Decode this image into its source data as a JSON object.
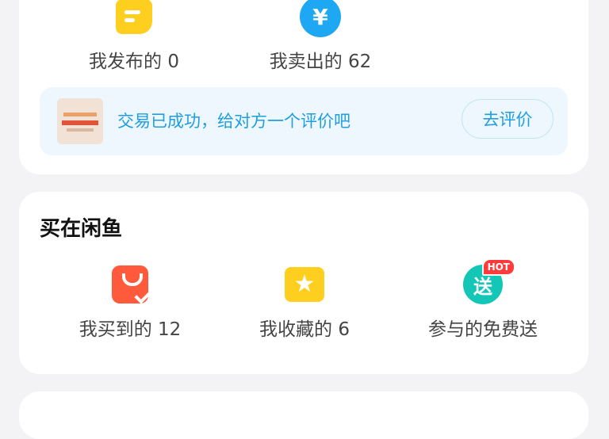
{
  "sell_section": {
    "items": [
      {
        "label": "我发布的 0",
        "icon": "note-icon"
      },
      {
        "label": "我卖出的 62",
        "icon": "yen-coin-icon",
        "glyph": "¥"
      }
    ],
    "banner": {
      "message": "交易已成功，给对方一个评价吧",
      "button_label": "去评价"
    }
  },
  "buy_section": {
    "title": "买在闲鱼",
    "items": [
      {
        "label": "我买到的 12",
        "icon": "shopping-bag-icon"
      },
      {
        "label": "我收藏的 6",
        "icon": "star-box-icon",
        "glyph": "★"
      },
      {
        "label": "参与的免费送",
        "icon": "free-gift-icon",
        "glyph": "送",
        "badge": "HOT"
      }
    ]
  },
  "colors": {
    "accent_blue": "#1e9ee0",
    "yellow": "#ffcf1f",
    "red": "#ff5a3c",
    "teal": "#14c6b5"
  }
}
